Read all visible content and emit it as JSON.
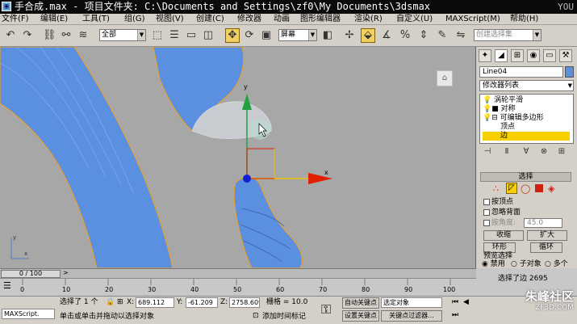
{
  "window": {
    "title": "手合成.max    - 项目文件夹: C:\\Documents and Settings\\zf0\\My Documents\\3dsmax",
    "corner_mark": "YOU"
  },
  "menu": [
    "文件(F)",
    "编辑(E)",
    "工具(T)",
    "组(G)",
    "视图(V)",
    "创建(C)",
    "修改器",
    "动画",
    "图形编辑器",
    "渲染(R)",
    "自定义(U)",
    "MAXScript(M)",
    "帮助(H)"
  ],
  "toolbar": {
    "selection_filter": "全部",
    "ref_coord": "屏幕",
    "named_selection": "创建选择集"
  },
  "viewport": {
    "axis_x": "x",
    "axis_y": "y",
    "corner_axis_y": "y",
    "corner_axis_x": "x"
  },
  "panel": {
    "object_name": "Line04",
    "modifier_list": "修改器列表",
    "stack": [
      "涡轮平滑",
      "对称",
      "可编辑多边形",
      "顶点",
      "边"
    ],
    "selection_rollout": "选择",
    "by_vertex": "按顶点",
    "ignore_backfacing": "忽略背面",
    "angle_label": "按角度:",
    "angle_value": "45.0",
    "shrink": "收缩",
    "grow": "扩大",
    "ring": "环形",
    "loop": "循环",
    "preview_label": "预览选择",
    "preview_options": [
      "禁用",
      "子对象",
      "多个"
    ],
    "selected_count": "选择了边 2695"
  },
  "timeline": {
    "frame_display": "0 / 100",
    "ticks": [
      "0",
      "10",
      "20",
      "30",
      "40",
      "50",
      "60",
      "70",
      "80",
      "90",
      "100"
    ]
  },
  "status": {
    "maxscript": "MAXScript.",
    "selected": "选择了 1 个",
    "x_label": "X:",
    "x_value": "689.112",
    "y_label": "Y:",
    "y_value": "-61.209",
    "z_label": "Z:",
    "z_value": "2758.609",
    "grid": "栅格 = 10.0",
    "auto_key": "自动关键点",
    "selected_obj": "选定对象",
    "set_key": "设置关键点",
    "key_filters": "关键点过滤器...",
    "prompt": "单击或单击并拖动以选择对象",
    "add_time_tag": "添加时间标记"
  },
  "watermark": {
    "name": "朱峰社区",
    "url": "ZF3D.COM"
  },
  "colors": {
    "object_blue": "#5b8fe0",
    "selection_yellow": "#f8d000",
    "x_axis_red": "#e02000",
    "y_axis_green": "#20a040"
  }
}
